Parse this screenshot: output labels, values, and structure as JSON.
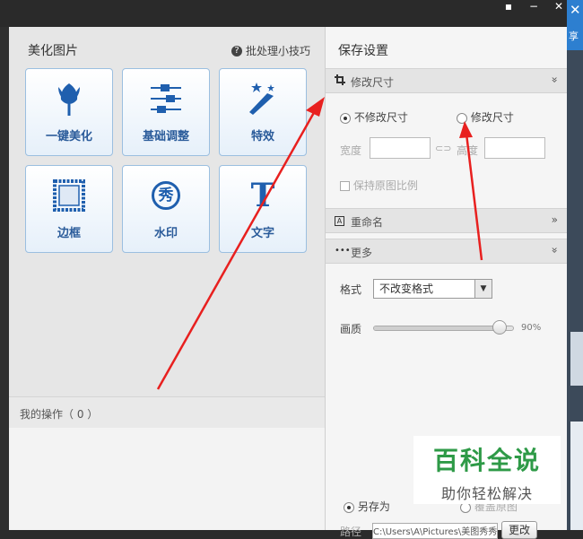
{
  "background": {
    "close_glyph": "✕",
    "share_glyph": "享"
  },
  "window_controls": {
    "menu": "▪",
    "minimize": "−",
    "close": "✕"
  },
  "left_panel": {
    "title": "美化图片",
    "batch_tips": "批处理小技巧",
    "tools": [
      {
        "label": "一键美化",
        "icon": "tulip-icon"
      },
      {
        "label": "基础调整",
        "icon": "sliders-icon"
      },
      {
        "label": "特效",
        "icon": "magic-wand-icon"
      },
      {
        "label": "边框",
        "icon": "frame-icon"
      },
      {
        "label": "水印",
        "icon": "watermark-icon"
      },
      {
        "label": "文字",
        "icon": "text-icon"
      }
    ],
    "text_icon_glyph": "T",
    "watermark_glyph": "秀",
    "my_operations": "我的操作（ 0 ）"
  },
  "right_panel": {
    "title": "保存设置",
    "resize_section": {
      "label": "修改尺寸",
      "chevron": "»"
    },
    "no_resize_option": "不修改尺寸",
    "resize_option": "修改尺寸",
    "width_label": "宽度",
    "height_label": "高度",
    "keep_ratio": "保持原图比例",
    "rename_section": {
      "label": "重命名",
      "chevron": "»"
    },
    "more_section": {
      "label": "更多",
      "chevron": "»"
    },
    "format_label": "格式",
    "format_value": "不改变格式",
    "quality_label": "画质",
    "quality_value": "90%",
    "quality_level": 0.9,
    "save_as": "另存为",
    "overwrite": "覆盖原图",
    "path_label": "路径",
    "path_value": "C:\\Users\\A\\Pictures\\美图秀秀",
    "change_button": "更改"
  },
  "watermark": {
    "title": "百科全说",
    "subtitle": "助你轻松解决"
  },
  "colors": {
    "arrow": "#e8201f",
    "accent_blue": "#2a5b9a",
    "watermark_green": "#2e9a47"
  }
}
